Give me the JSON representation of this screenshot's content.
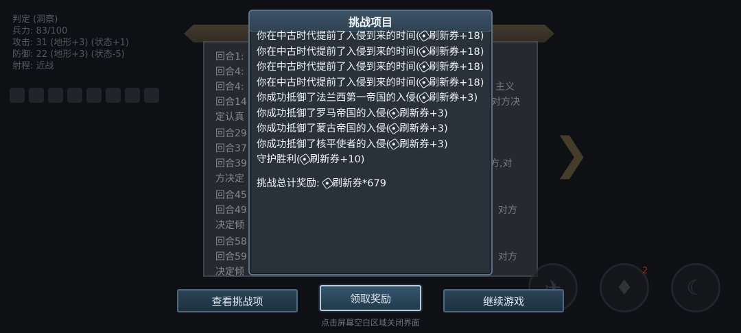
{
  "background": {
    "stats": [
      "判定 (洞察)",
      "兵力: 83/100",
      "攻击: 31 (地形+3) (状态+1)",
      "防御: 22 (地形+3) (状态-5)",
      "射程: 近战"
    ],
    "log_left": [
      "回合1:",
      "回合4:",
      "回合4:",
      "回合14",
      "定认真",
      "回合29",
      "回合37",
      "回合39",
      "方决定",
      "回合45",
      "回合49",
      "决定倾",
      "回合58",
      "回合59",
      "决定倾"
    ],
    "log_right": [
      {
        "text": "主义"
      },
      {
        "text": "对方决"
      },
      {
        "text": "对方,对"
      },
      {
        "text": "对方"
      },
      {
        "text": "对方"
      }
    ],
    "badge": "2"
  },
  "modal": {
    "title": "挑战项目",
    "entries": [
      {
        "text": "你在中古时代提前了入侵到来的时间(",
        "reward": "刷新券",
        "amount": "+18)"
      },
      {
        "text": "你在中古时代提前了入侵到来的时间(",
        "reward": "刷新券",
        "amount": "+18)"
      },
      {
        "text": "你在中古时代提前了入侵到来的时间(",
        "reward": "刷新券",
        "amount": "+18)"
      },
      {
        "text": "你在中古时代提前了入侵到来的时间(",
        "reward": "刷新券",
        "amount": "+18)"
      },
      {
        "text": "你成功抵御了法兰西第一帝国的入侵(",
        "reward": "刷新券",
        "amount": "+3)"
      },
      {
        "text": "你成功抵御了罗马帝国的入侵(",
        "reward": "刷新券",
        "amount": "+3)"
      },
      {
        "text": "你成功抵御了蒙古帝国的入侵(",
        "reward": "刷新券",
        "amount": "+3)"
      },
      {
        "text": "你成功抵御了核平使者的入侵(",
        "reward": "刷新券",
        "amount": "+3)"
      },
      {
        "text": "守护胜利(",
        "reward": "刷新券",
        "amount": "+10)"
      }
    ],
    "total_label": "挑战总计奖励: ",
    "total_reward": "刷新券",
    "total_amount": "*679"
  },
  "buttons": {
    "view": "查看挑战项",
    "claim": "领取奖励",
    "continue": "继续游戏"
  },
  "hint": "点击屏幕空白区域关闭界面",
  "icons": {
    "ticket": "ticket-icon",
    "next": "chevron-right-icon",
    "helmet": "helmet-icon",
    "moon": "sleep-moon-icon",
    "wing": "wing-icon"
  }
}
